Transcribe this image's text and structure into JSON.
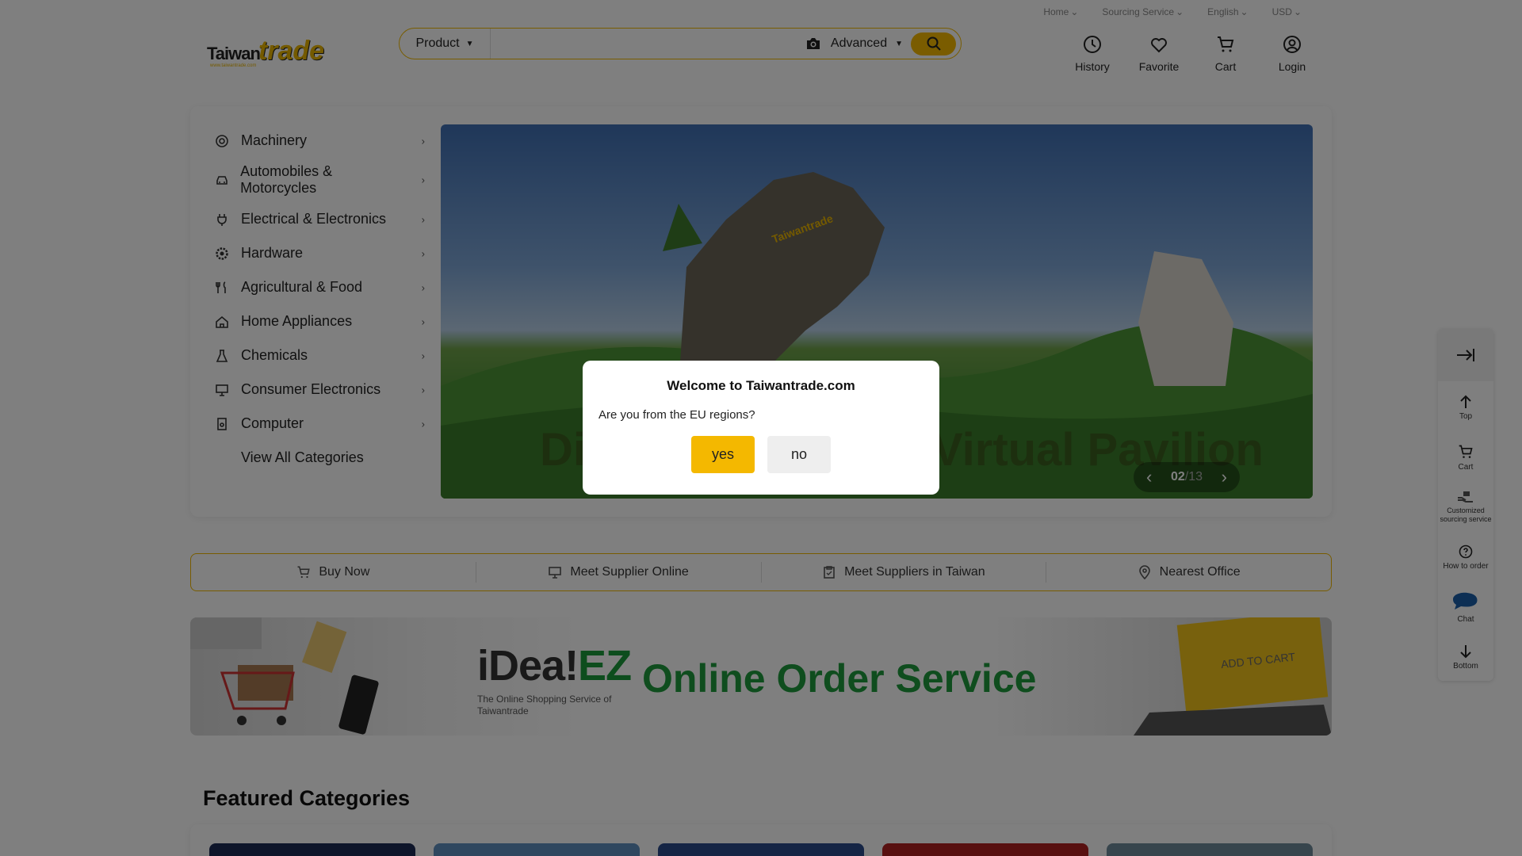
{
  "top_links": [
    {
      "label": "Home"
    },
    {
      "label": "Sourcing Service"
    },
    {
      "label": "English"
    },
    {
      "label": "USD"
    }
  ],
  "logo": {
    "text_a": "Taiwan",
    "text_b": "trade",
    "sub": "www.taiwantrade.com"
  },
  "search": {
    "category": "Product",
    "placeholder": "",
    "advanced_label": "Advanced"
  },
  "header_icons": [
    {
      "label": "History",
      "icon": "clock-icon"
    },
    {
      "label": "Favorite",
      "icon": "heart-icon"
    },
    {
      "label": "Cart",
      "icon": "cart-icon"
    },
    {
      "label": "Login",
      "icon": "user-icon"
    }
  ],
  "categories": [
    {
      "label": "Machinery",
      "icon": "machinery-icon"
    },
    {
      "label": "Automobiles & Motorcycles",
      "icon": "car-icon"
    },
    {
      "label": "Electrical & Electronics",
      "icon": "plug-icon"
    },
    {
      "label": "Hardware",
      "icon": "gear-icon"
    },
    {
      "label": "Agricultural & Food",
      "icon": "utensils-icon"
    },
    {
      "label": "Home Appliances",
      "icon": "home-icon"
    },
    {
      "label": "Chemicals",
      "icon": "flask-icon"
    },
    {
      "label": "Consumer Electronics",
      "icon": "monitor-icon"
    },
    {
      "label": "Computer",
      "icon": "computer-icon"
    }
  ],
  "view_all": "View All Categories",
  "banner": {
    "headline_left": "Di",
    "headline_right": "Virtual Pavilion",
    "horse_text": "Taiwantrade",
    "page_current": "02",
    "page_sep": "/",
    "page_total": "13"
  },
  "modal": {
    "title": "Welcome to Taiwantrade.com",
    "question": "Are you from the EU regions?",
    "yes": "yes",
    "no": "no"
  },
  "services": [
    {
      "label": "Buy Now",
      "icon": "cart-icon"
    },
    {
      "label": "Meet Supplier Online",
      "icon": "monitor-icon"
    },
    {
      "label": "Meet Suppliers in Taiwan",
      "icon": "clipboard-icon"
    },
    {
      "label": "Nearest Office",
      "icon": "location-pin-icon"
    }
  ],
  "promo": {
    "brand_a": "iDea!",
    "brand_b": "EZ",
    "tagline": "The Online Shopping Service of Taiwantrade",
    "title": "Online Order Service",
    "laptop_text": "ADD TO CART"
  },
  "featured_title": "Featured Categories",
  "right_bar": [
    {
      "label": "Top",
      "icon": "arrow-up-icon"
    },
    {
      "label": "Cart",
      "icon": "cart-icon"
    },
    {
      "label": "Customized sourcing service",
      "icon": "hand-box-icon"
    },
    {
      "label": "How to order",
      "icon": "question-icon"
    },
    {
      "label": "Chat",
      "icon": "chat-icon"
    },
    {
      "label": "Bottom",
      "icon": "arrow-down-icon"
    }
  ],
  "colors": {
    "accent": "#f4b800",
    "green": "#1e9a3c",
    "overlay": "rgba(0,0,0,0.5)"
  }
}
